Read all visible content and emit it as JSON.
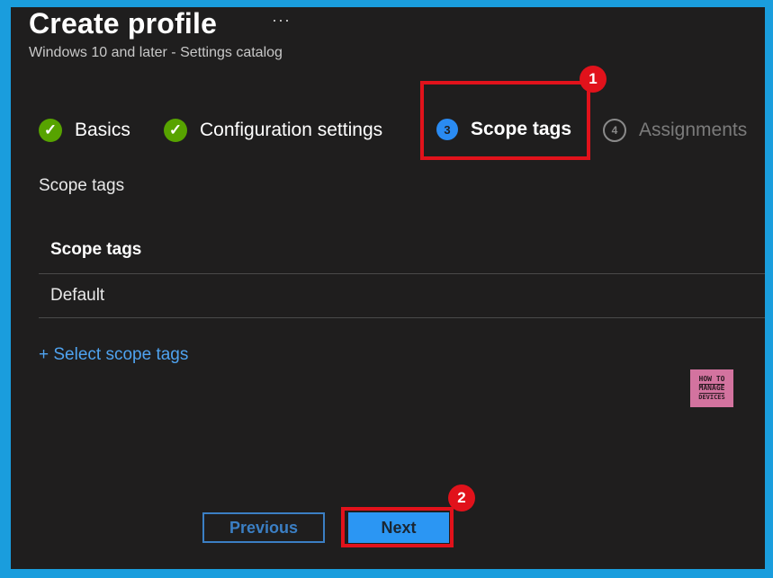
{
  "header": {
    "title": "Create profile",
    "more": "···",
    "subtitle": "Windows 10 and later - Settings catalog"
  },
  "steps": [
    {
      "label": "Basics",
      "status": "complete",
      "icon": "check-icon"
    },
    {
      "label": "Configuration settings",
      "status": "complete",
      "icon": "check-icon"
    },
    {
      "label": "Scope tags",
      "status": "active",
      "number": "3"
    },
    {
      "label": "Assignments",
      "status": "inactive",
      "number": "4"
    }
  ],
  "callouts": {
    "one": "1",
    "two": "2"
  },
  "section": {
    "label": "Scope tags"
  },
  "table": {
    "header": "Scope tags",
    "rows": [
      "Default"
    ]
  },
  "select_link": "+ Select scope tags",
  "logo": {
    "line1": "HOW TO",
    "line2": "MANAGE",
    "line3": "DEVICES"
  },
  "footer": {
    "previous_label": "Previous",
    "next_label": "Next"
  },
  "colors": {
    "accent": "#2b96f3",
    "highlight": "#e1121b",
    "success": "#57a300",
    "background": "#1f1e1e",
    "frame": "#1a9ddd"
  }
}
